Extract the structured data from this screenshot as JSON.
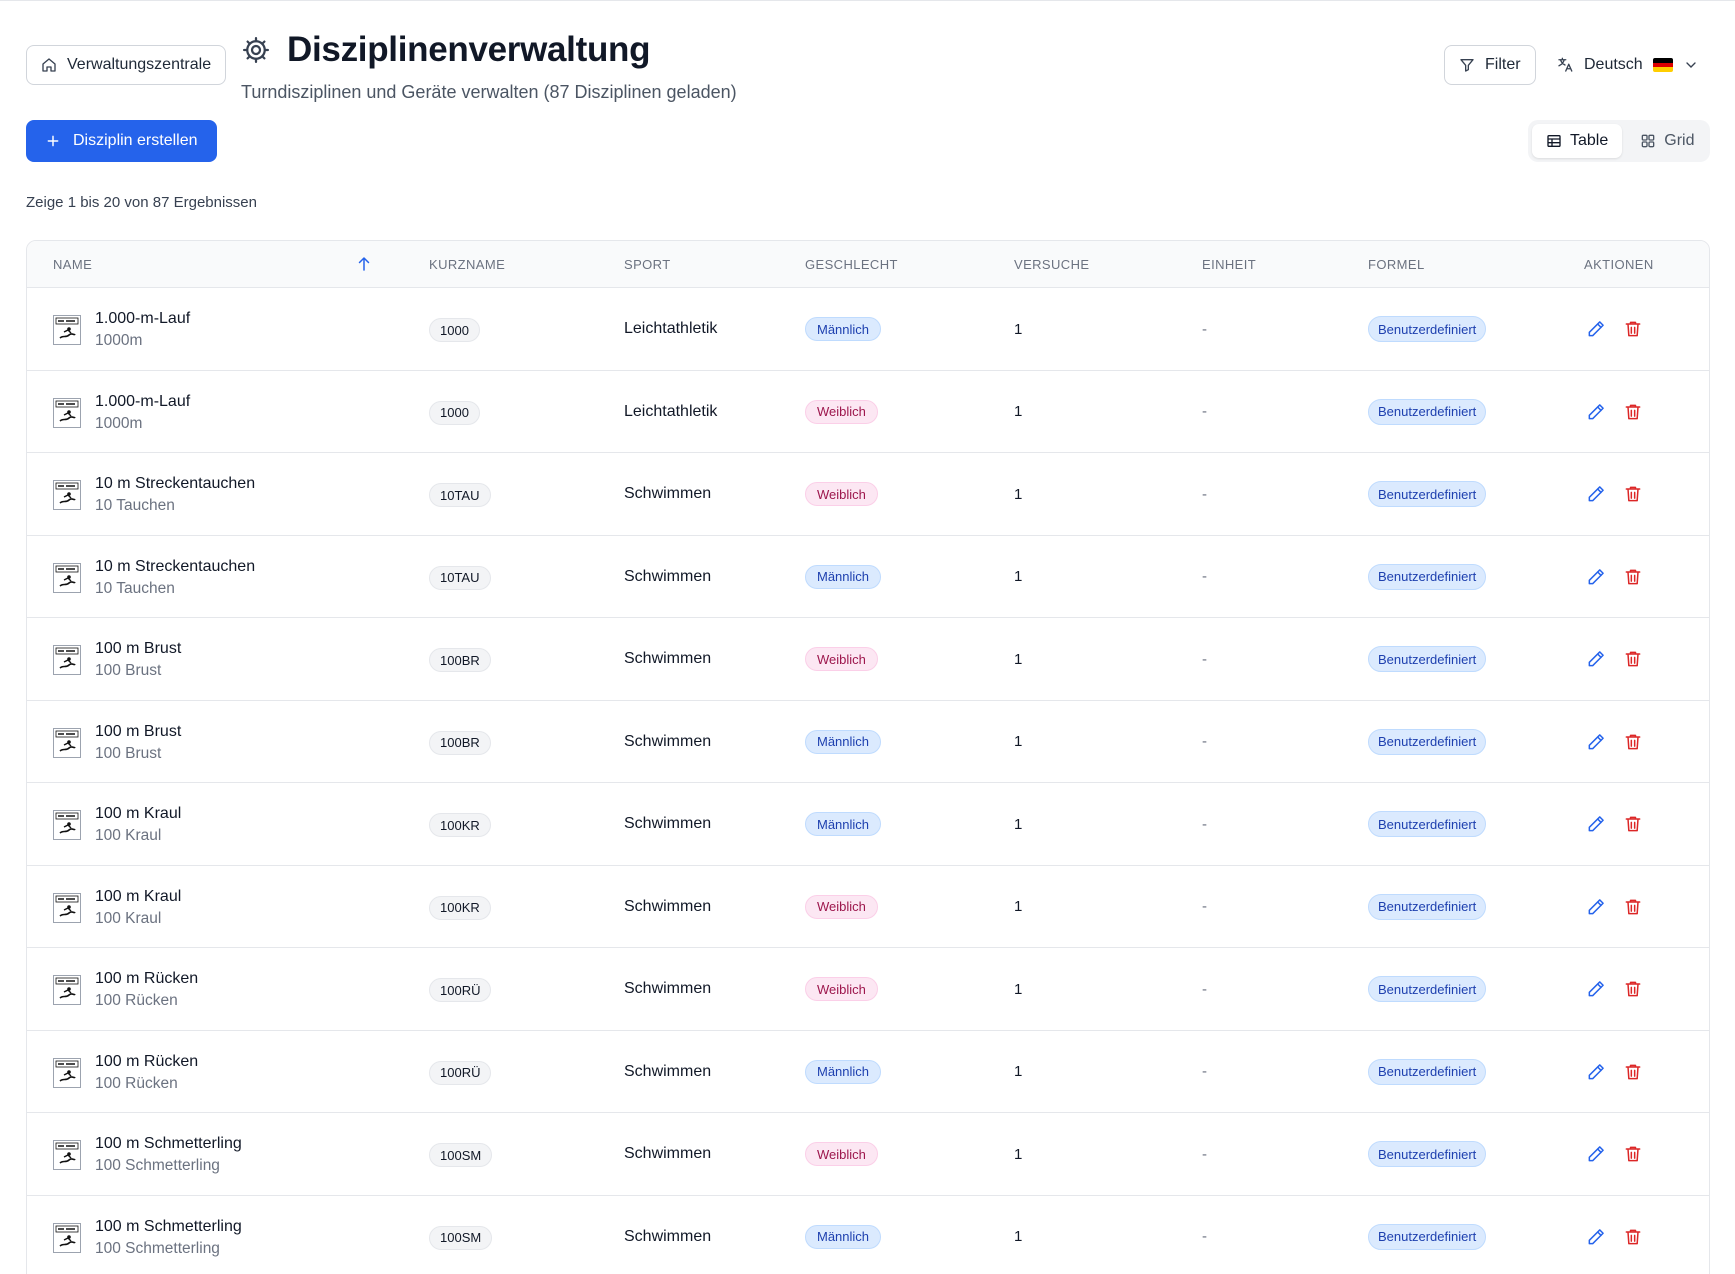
{
  "header": {
    "home_label": "Verwaltungszentrale",
    "title": "Disziplinenverwaltung",
    "subtitle": "Turndisziplinen und Geräte verwalten (87 Disziplinen geladen)",
    "filter_label": "Filter",
    "language_label": "Deutsch",
    "flag_colors": [
      "#000000",
      "#dd0000",
      "#ffce00"
    ]
  },
  "toolbar": {
    "create_label": "Disziplin erstellen",
    "view_table": "Table",
    "view_grid": "Grid",
    "active_view": "Table"
  },
  "results_text": "Zeige 1 bis 20 von 87 Ergebnissen",
  "table": {
    "columns": [
      "Name",
      "Kurzname",
      "Sport",
      "Geschlecht",
      "Versuche",
      "Einheit",
      "Formel",
      "Aktionen"
    ],
    "sorted_column": "Name",
    "sort_direction": "ascending",
    "rows": [
      {
        "name": "1.000-m-Lauf",
        "sub": "1000m",
        "short": "1000",
        "sport": "Leichtathletik",
        "gender": "Männlich",
        "tries": "1",
        "unit": "-",
        "formula": "Benutzerdefiniert"
      },
      {
        "name": "1.000-m-Lauf",
        "sub": "1000m",
        "short": "1000",
        "sport": "Leichtathletik",
        "gender": "Weiblich",
        "tries": "1",
        "unit": "-",
        "formula": "Benutzerdefiniert"
      },
      {
        "name": "10 m Streckentauchen",
        "sub": "10 Tauchen",
        "short": "10TAU",
        "sport": "Schwimmen",
        "gender": "Weiblich",
        "tries": "1",
        "unit": "-",
        "formula": "Benutzerdefiniert"
      },
      {
        "name": "10 m Streckentauchen",
        "sub": "10 Tauchen",
        "short": "10TAU",
        "sport": "Schwimmen",
        "gender": "Männlich",
        "tries": "1",
        "unit": "-",
        "formula": "Benutzerdefiniert"
      },
      {
        "name": "100 m Brust",
        "sub": "100 Brust",
        "short": "100BR",
        "sport": "Schwimmen",
        "gender": "Weiblich",
        "tries": "1",
        "unit": "-",
        "formula": "Benutzerdefiniert"
      },
      {
        "name": "100 m Brust",
        "sub": "100 Brust",
        "short": "100BR",
        "sport": "Schwimmen",
        "gender": "Männlich",
        "tries": "1",
        "unit": "-",
        "formula": "Benutzerdefiniert"
      },
      {
        "name": "100 m Kraul",
        "sub": "100 Kraul",
        "short": "100KR",
        "sport": "Schwimmen",
        "gender": "Männlich",
        "tries": "1",
        "unit": "-",
        "formula": "Benutzerdefiniert"
      },
      {
        "name": "100 m Kraul",
        "sub": "100 Kraul",
        "short": "100KR",
        "sport": "Schwimmen",
        "gender": "Weiblich",
        "tries": "1",
        "unit": "-",
        "formula": "Benutzerdefiniert"
      },
      {
        "name": "100 m Rücken",
        "sub": "100 Rücken",
        "short": "100RÜ",
        "sport": "Schwimmen",
        "gender": "Weiblich",
        "tries": "1",
        "unit": "-",
        "formula": "Benutzerdefiniert"
      },
      {
        "name": "100 m Rücken",
        "sub": "100 Rücken",
        "short": "100RÜ",
        "sport": "Schwimmen",
        "gender": "Männlich",
        "tries": "1",
        "unit": "-",
        "formula": "Benutzerdefiniert"
      },
      {
        "name": "100 m Schmetterling",
        "sub": "100 Schmetterling",
        "short": "100SM",
        "sport": "Schwimmen",
        "gender": "Weiblich",
        "tries": "1",
        "unit": "-",
        "formula": "Benutzerdefiniert"
      },
      {
        "name": "100 m Schmetterling",
        "sub": "100 Schmetterling",
        "short": "100SM",
        "sport": "Schwimmen",
        "gender": "Männlich",
        "tries": "1",
        "unit": "-",
        "formula": "Benutzerdefiniert"
      }
    ]
  },
  "colors": {
    "primary": "#2563eb",
    "male_badge": "#dbeafe",
    "female_badge": "#fce7f3",
    "edit_icon": "#2563eb",
    "delete_icon": "#dc2626"
  },
  "icons": [
    "home-icon",
    "gear-icon",
    "filter-icon",
    "translate-icon",
    "chevron-down-icon",
    "plus-icon",
    "table-icon",
    "grid-icon",
    "sort-ascending-icon",
    "pencil-icon",
    "trash-icon"
  ]
}
